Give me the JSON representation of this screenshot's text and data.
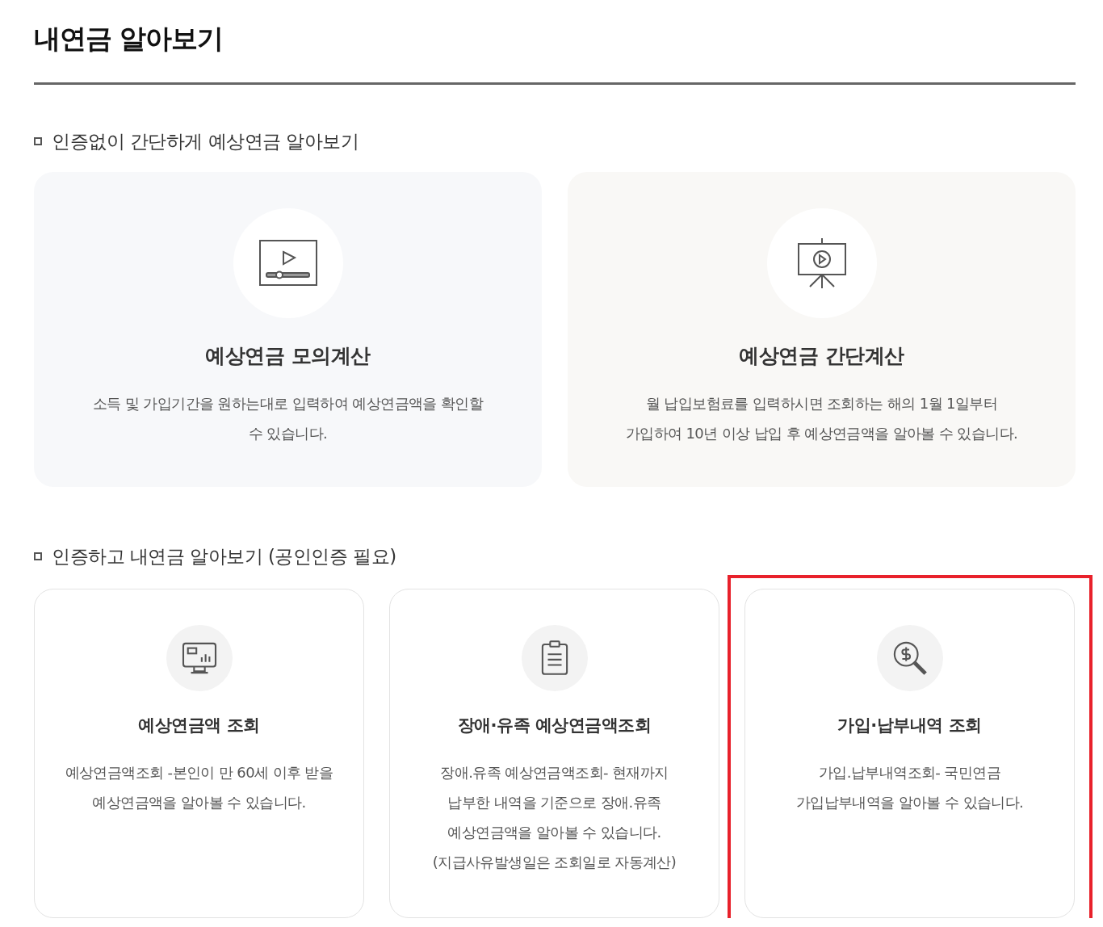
{
  "page_title": "내연금 알아보기",
  "sections": [
    {
      "heading": "인증없이 간단하게 예상연금 알아보기",
      "kind": "large",
      "cards": [
        {
          "title": "예상연금 모의계산",
          "description": [
            "소득 및 가입기간을 원하는대로 입력하여 예상연금액을 확인할",
            "수 있습니다."
          ],
          "highlighted": false
        },
        {
          "title": "예상연금 간단계산",
          "description": [
            "월 납입보험료를 입력하시면 조회하는 해의 1월 1일부터",
            "가입하여 10년 이상 납입 후 예상연금액을 알아볼 수 있습니다."
          ],
          "highlighted": false
        }
      ]
    },
    {
      "heading": "인증하고 내연금 알아보기 (공인인증 필요)",
      "kind": "small",
      "cards": [
        {
          "title": "예상연금액 조회",
          "description": [
            "예상연금액조회 -본인이 만 60세 이후 받을",
            "예상연금액을 알아볼 수 있습니다."
          ],
          "highlighted": false
        },
        {
          "title": "장애·유족 예상연금액조회",
          "description": [
            "장애.유족 예상연금액조회- 현재까지",
            "납부한 내역을 기준으로 장애.유족",
            "예상연금액을 알아볼 수 있습니다.",
            "(지급사유발생일은 조회일로 자동계산)"
          ],
          "highlighted": false
        },
        {
          "title": "가입·납부내역 조회",
          "description": [
            "가입.납부내역조회- 국민연금",
            "가입납부내역을 알아볼 수 있습니다."
          ],
          "highlighted": true
        }
      ]
    }
  ]
}
